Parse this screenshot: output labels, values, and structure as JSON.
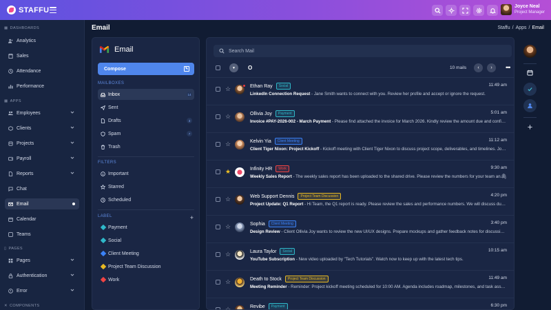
{
  "brand": {
    "name": "STAFFU"
  },
  "user": {
    "name": "Joyce Neal",
    "role": "Project Manager"
  },
  "topbar_icons": [
    "search-icon",
    "moon-icon",
    "fullscreen-icon",
    "gear-icon",
    "bell-icon"
  ],
  "sidebar": {
    "sections": [
      {
        "label": "DASHBOARDS"
      },
      {
        "label": "APPS"
      },
      {
        "label": "PAGES"
      },
      {
        "label": "COMPONENTS"
      }
    ],
    "items": [
      {
        "label": "Analytics",
        "icon": "users-icon"
      },
      {
        "label": "Sales",
        "icon": "store-icon"
      },
      {
        "label": "Attendance",
        "icon": "clock-icon"
      },
      {
        "label": "Performance",
        "icon": "bar-chart-icon"
      },
      {
        "label": "Employees",
        "icon": "people-icon"
      },
      {
        "label": "Clients",
        "icon": "box-icon"
      },
      {
        "label": "Projects",
        "icon": "folder-icon"
      },
      {
        "label": "Payroll",
        "icon": "wallet-icon"
      },
      {
        "label": "Reports",
        "icon": "file-icon"
      },
      {
        "label": "Chat",
        "icon": "chat-icon"
      },
      {
        "label": "Email",
        "icon": "mail-icon"
      },
      {
        "label": "Calendar",
        "icon": "calendar-icon"
      },
      {
        "label": "Teams",
        "icon": "team-icon"
      },
      {
        "label": "Pages",
        "icon": "page-icon"
      },
      {
        "label": "Authentication",
        "icon": "lock-icon"
      },
      {
        "label": "Error",
        "icon": "error-icon"
      }
    ]
  },
  "header": {
    "title": "Email",
    "breadcrumb": [
      "Staffu",
      "/",
      "Apps",
      "/",
      "Email"
    ]
  },
  "leftpanel": {
    "title": "Email",
    "compose_label": "Compose",
    "mailboxes_label": "MAILBOXES",
    "mailboxes": [
      {
        "label": "Inbox",
        "count": "14"
      },
      {
        "label": "Sent",
        "count": ""
      },
      {
        "label": "Drafts",
        "count": "3"
      },
      {
        "label": "Spam",
        "count": "7"
      },
      {
        "label": "Trash",
        "count": ""
      }
    ],
    "filters_label": "FILTERS",
    "filters": [
      {
        "label": "Important"
      },
      {
        "label": "Starred"
      },
      {
        "label": "Scheduled"
      }
    ],
    "label_label": "LABEL",
    "labels": [
      {
        "label": "Payment",
        "color": "#2fb8c9"
      },
      {
        "label": "Social",
        "color": "#2fb8c9"
      },
      {
        "label": "Client Meeting",
        "color": "#3b82f6"
      },
      {
        "label": "Project Team Discussion",
        "color": "#e8b923"
      },
      {
        "label": "Work",
        "color": "#ef4444"
      }
    ]
  },
  "search": {
    "placeholder": "Search Mail"
  },
  "toolbar": {
    "o_label": "O",
    "count": "10 mails"
  },
  "mails": [
    {
      "from": "Ethan Ray",
      "badge": "Social",
      "badge_color": "#2fb8c9",
      "subject": "LinkedIn Connection Request",
      "preview": " - Jane Smith wants to connect with you. Review her profile and accept or ignore the request.",
      "time": "11:49 am",
      "starred": false,
      "attachment": false,
      "pin": true
    },
    {
      "from": "Ollivia Joy",
      "badge": "Payment",
      "badge_color": "#2fb8c9",
      "subject": "Invoice #PAY-2026-002 - March Payment",
      "preview": " - Please find attached the invoice for March 2026. Kindly review the amount due and confirm payment.",
      "time": "5:01 am",
      "starred": false,
      "attachment": false,
      "pin": false
    },
    {
      "from": "Kelvin Yia",
      "badge": "Client Meeting",
      "badge_color": "#3b82f6",
      "subject": "Client Tiger Nixon: Project Kickoff",
      "preview": " - Kickoff meeting with Client Tiger Nixon to discuss project scope, deliverables, and timelines. Join via Zoom.",
      "time": "11:12 am",
      "starred": false,
      "attachment": false,
      "pin": false
    },
    {
      "from": "Infinity HR",
      "badge": "Work",
      "badge_color": "#ef4444",
      "subject": "Weekly Sales Report",
      "preview": " - The weekly sales report has been uploaded to the shared drive. Please review the numbers for your team and provide feedback.",
      "time": "9:30 am",
      "starred": true,
      "attachment": true,
      "pin": false
    },
    {
      "from": "Web Support Dennis",
      "badge": "Project Team Discussion",
      "badge_color": "#e8b923",
      "subject": "Project Update: Q1 Report",
      "preview": " - Hi Team, the Q1 report is ready. Please review the sales and performance numbers. We will discuss during the meeting.",
      "time": "4:20 pm",
      "starred": false,
      "attachment": false,
      "pin": false
    },
    {
      "from": "Sophia",
      "badge": "Client Meeting",
      "badge_color": "#3b82f6",
      "subject": "Design Review",
      "preview": " - Client Ollivia Joy wants to review the new UI/UX designs. Prepare mockups and gather feedback notes for discussion.",
      "time": "3:40 pm",
      "starred": false,
      "attachment": false,
      "pin": false
    },
    {
      "from": "Laura Taylor",
      "badge": "Social",
      "badge_color": "#2fb8c9",
      "subject": "YouTube Subscription",
      "preview": " - New video uploaded by \"Tech Tutorials\". Watch now to keep up with the latest tech tips.",
      "time": "10:15 am",
      "starred": false,
      "attachment": false,
      "pin": false
    },
    {
      "from": "Death to Stock",
      "badge": "Project Team Discussion",
      "badge_color": "#e8b923",
      "subject": "Meeting Reminder",
      "preview": " - Reminder: Project kickoff meeting scheduled for 10:00 AM. Agenda includes roadmap, milestones, and task assignments.",
      "time": "11:49 am",
      "starred": false,
      "attachment": false,
      "pin": false
    },
    {
      "from": "Revibe",
      "badge": "Payment",
      "badge_color": "#2fb8c9",
      "subject": "",
      "preview": "",
      "time": "6:30 pm",
      "starred": false,
      "attachment": false,
      "pin": false
    }
  ]
}
